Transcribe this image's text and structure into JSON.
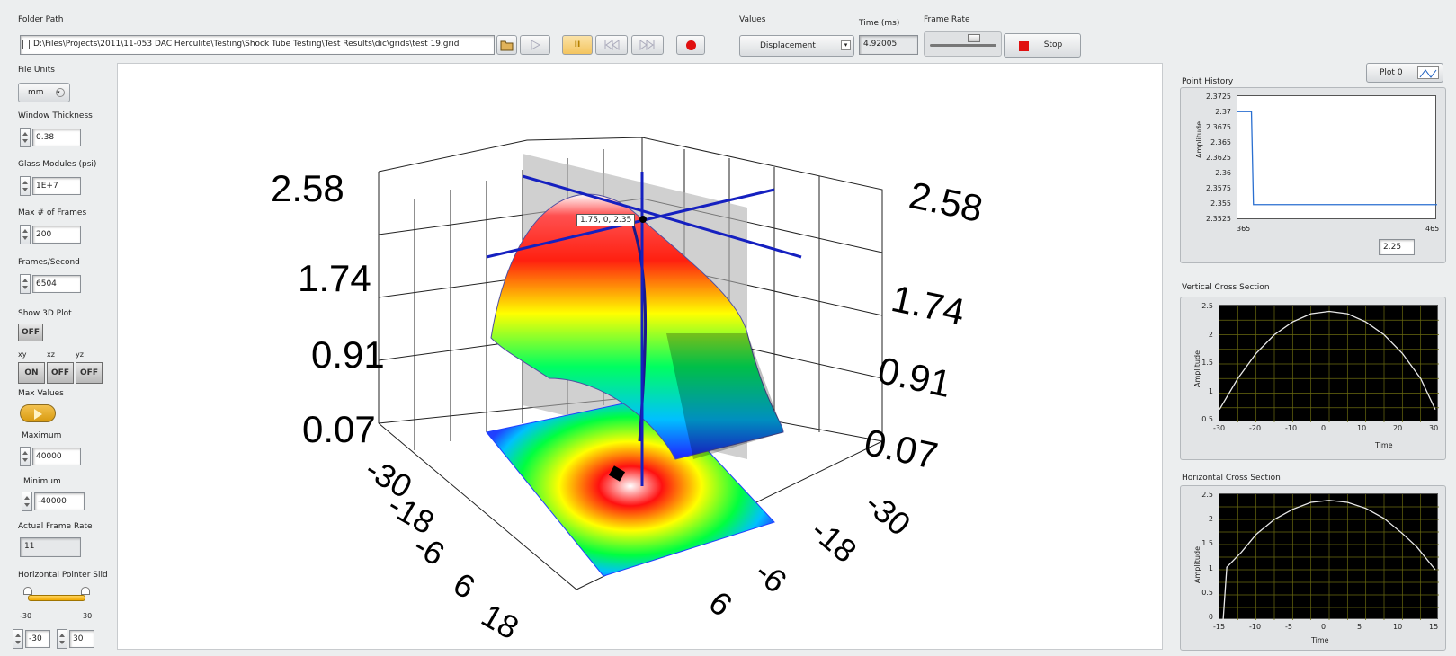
{
  "toolbar": {
    "folder_path_label": "Folder Path",
    "folder_path_value": "D:\\Files\\Projects\\2011\\11-053 DAC Herculite\\Testing\\Shock Tube Testing\\Test Results\\dic\\grids\\test 19.grid",
    "values_label": "Values",
    "values_selected": "Displacement",
    "time_label": "Time (ms)",
    "time_value": "4.92005",
    "frame_rate_label": "Frame Rate",
    "stop_label": "Stop",
    "pause_label": "II"
  },
  "left_panel": {
    "file_units_label": "File Units",
    "file_units_value": "mm",
    "window_thickness_label": "Window Thickness",
    "window_thickness_value": "0.38",
    "glass_modulus_label": "Glass Modules (psi)",
    "glass_modulus_value": "1E+7",
    "max_frames_label": "Max # of Frames",
    "max_frames_value": "200",
    "fps_label": "Frames/Second",
    "fps_value": "6504",
    "show3d_label": "Show 3D Plot",
    "show3d_value": "OFF",
    "xy_label": "xy",
    "xz_label": "xz",
    "yz_label": "yz",
    "xy_value": "ON",
    "xz_value": "OFF",
    "yz_value": "OFF",
    "max_values_label": "Max Values",
    "maximum_label": "Maximum",
    "maximum_value": "40000",
    "minimum_label": "Minimum",
    "minimum_value": "-40000",
    "actual_rate_label": "Actual Frame Rate",
    "actual_rate_value": "11",
    "hslider_label": "Horizontal Pointer Slid",
    "hslider_min": "-30",
    "hslider_max": "30",
    "hslider_low_value": "-30",
    "hslider_high_value": "30"
  },
  "plot3d": {
    "z_ticks_left": [
      "2.58",
      "1.74",
      "0.91",
      "0.07"
    ],
    "z_ticks_right": [
      "2.58",
      "1.74",
      "0.91",
      "0.07"
    ],
    "x_ticks": [
      "-30",
      "-18",
      "-6",
      "6",
      "18"
    ],
    "y_ticks": [
      "-30",
      "-18",
      "-6",
      "6"
    ],
    "cursor_label": "1.75, 0, 2.35"
  },
  "point_history": {
    "title": "Point History",
    "plot_legend": "Plot 0",
    "ylabel": "Amplitude",
    "y_ticks": [
      "2.3725",
      "2.37",
      "2.3675",
      "2.365",
      "2.3625",
      "2.36",
      "2.3575",
      "2.355",
      "2.3525"
    ],
    "x_ticks": [
      "365",
      "465"
    ],
    "cursor_value": "2.25"
  },
  "vertical_cs": {
    "title": "Vertical Cross Section",
    "ylabel": "Amplitude",
    "xlabel": "Time",
    "y_ticks": [
      "2.5",
      "2",
      "1.5",
      "1",
      "0.5"
    ],
    "x_ticks": [
      "-30",
      "-20",
      "-10",
      "0",
      "10",
      "20",
      "30"
    ]
  },
  "horizontal_cs": {
    "title": "Horizontal Cross Section",
    "ylabel": "Amplitude",
    "xlabel": "Time",
    "y_ticks": [
      "2.5",
      "2",
      "1.5",
      "1",
      "0.5",
      "0"
    ],
    "x_ticks": [
      "-15",
      "-10",
      "-5",
      "0",
      "5",
      "10",
      "15"
    ]
  },
  "chart_data": [
    {
      "type": "line",
      "title": "Point History",
      "ylabel": "Amplitude",
      "xlim": [
        365,
        465
      ],
      "ylim": [
        2.3525,
        2.3725
      ],
      "x": [
        365,
        372,
        373,
        465
      ],
      "values": [
        2.37,
        2.37,
        2.355,
        2.355
      ],
      "grid": false
    },
    {
      "type": "line",
      "title": "Vertical Cross Section",
      "xlabel": "Time",
      "ylabel": "Amplitude",
      "xlim": [
        -30,
        30
      ],
      "ylim": [
        0.5,
        2.5
      ],
      "x": [
        -30,
        -25,
        -20,
        -15,
        -10,
        -5,
        0,
        5,
        10,
        15,
        20,
        25,
        29
      ],
      "values": [
        0.72,
        1.25,
        1.68,
        2.0,
        2.22,
        2.36,
        2.4,
        2.36,
        2.22,
        2.0,
        1.68,
        1.25,
        0.72
      ],
      "grid": true
    },
    {
      "type": "line",
      "title": "Horizontal Cross Section",
      "xlabel": "Time",
      "ylabel": "Amplitude",
      "xlim": [
        -15,
        15
      ],
      "ylim": [
        0,
        2.5
      ],
      "x": [
        -14.5,
        -14,
        -12,
        -10,
        -7.5,
        -5,
        -2.5,
        0,
        2.5,
        5,
        7.5,
        10,
        12,
        14.5
      ],
      "values": [
        0.0,
        1.05,
        1.35,
        1.7,
        2.0,
        2.2,
        2.34,
        2.38,
        2.34,
        2.22,
        2.02,
        1.72,
        1.45,
        1.0
      ],
      "grid": true
    }
  ]
}
